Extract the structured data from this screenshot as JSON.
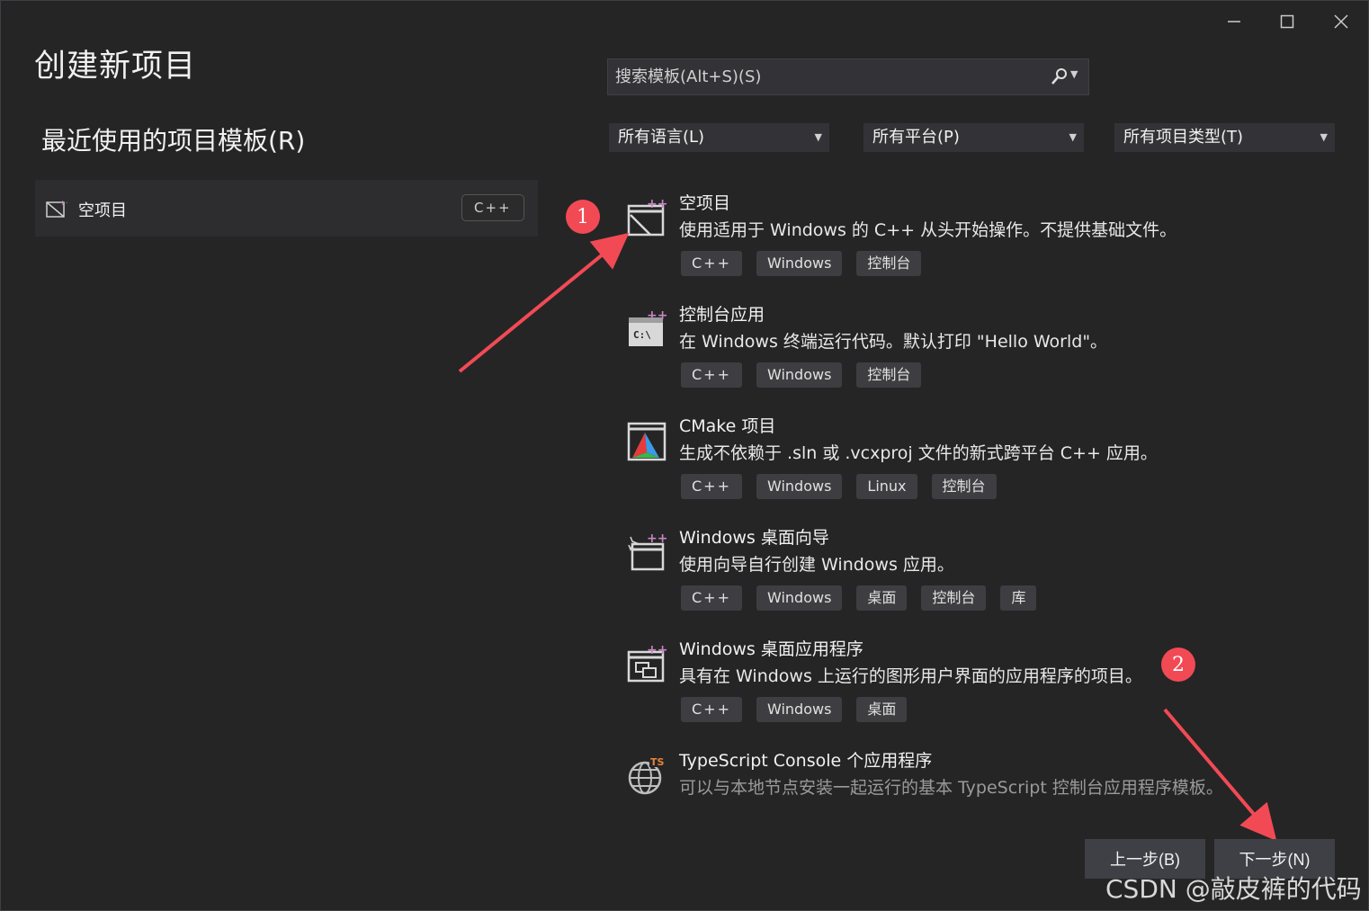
{
  "window": {
    "title": "创建新项目",
    "controls": {
      "minimize": "—",
      "maximize": "☐",
      "close": "✕"
    }
  },
  "recent": {
    "heading": "最近使用的项目模板(R)",
    "items": [
      {
        "label": "空项目",
        "tag": "C++"
      }
    ]
  },
  "search": {
    "placeholder": "搜索模板(Alt+S)(S)"
  },
  "filters": [
    {
      "label": "所有语言(L)"
    },
    {
      "label": "所有平台(P)"
    },
    {
      "label": "所有项目类型(T)"
    }
  ],
  "templates": [
    {
      "name": "空项目",
      "description": "使用适用于 Windows 的 C++ 从头开始操作。不提供基础文件。",
      "tags": [
        "C++",
        "Windows",
        "控制台"
      ],
      "icon": "empty-project-icon"
    },
    {
      "name": "控制台应用",
      "description": "在 Windows 终端运行代码。默认打印 \"Hello World\"。",
      "tags": [
        "C++",
        "Windows",
        "控制台"
      ],
      "icon": "console-app-icon"
    },
    {
      "name": "CMake 项目",
      "description": "生成不依赖于 .sln 或 .vcxproj 文件的新式跨平台 C++ 应用。",
      "tags": [
        "C++",
        "Windows",
        "Linux",
        "控制台"
      ],
      "icon": "cmake-icon"
    },
    {
      "name": "Windows 桌面向导",
      "description": "使用向导自行创建 Windows 应用。",
      "tags": [
        "C++",
        "Windows",
        "桌面",
        "控制台",
        "库"
      ],
      "icon": "desktop-wizard-icon"
    },
    {
      "name": "Windows 桌面应用程序",
      "description": "具有在 Windows 上运行的图形用户界面的应用程序的项目。",
      "tags": [
        "C++",
        "Windows",
        "桌面"
      ],
      "icon": "desktop-app-icon"
    },
    {
      "name": "TypeScript Console 个应用程序",
      "description": "可以与本地节点安装一起运行的基本 TypeScript 控制台应用程序模板。",
      "tags": [],
      "icon": "typescript-globe-icon"
    }
  ],
  "buttons": {
    "back": "上一步(B)",
    "next": "下一步(N)"
  },
  "annotations": {
    "marker1": "1",
    "marker2": "2"
  },
  "watermark": "CSDN @敲皮裤的代码",
  "colors": {
    "background": "#252526",
    "accent": "#f24a55",
    "tag_bg": "#3e3e42"
  }
}
